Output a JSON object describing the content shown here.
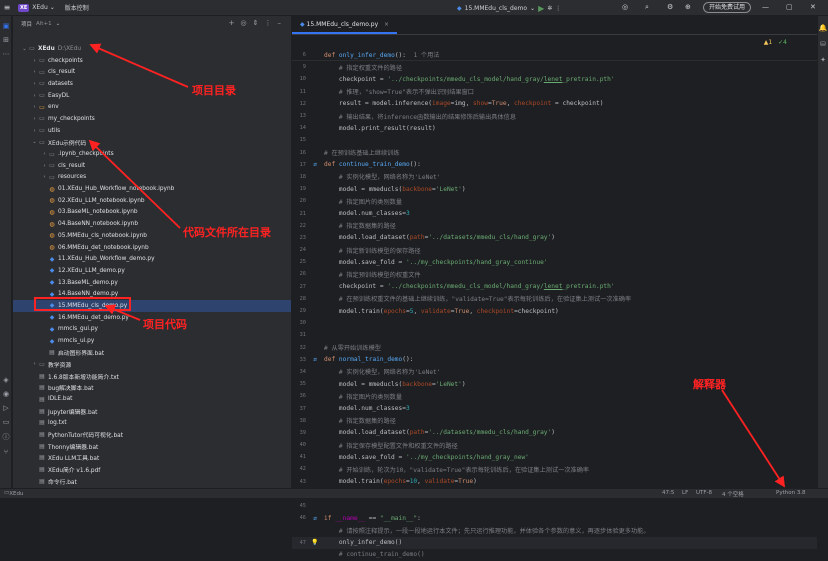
{
  "titlebar": {
    "logo": "XE",
    "project": "XEdu",
    "project_chev": "⌄",
    "vcs": "版本控制",
    "run_config": "15.MMEdu_cls_demo",
    "trial_button": "开始免费试用"
  },
  "project_panel": {
    "title": "项目",
    "shortcut": "Alt+1"
  },
  "tree": [
    {
      "label": "XEdu",
      "path": "D:\\XEdu",
      "depth": 0,
      "chev": "⌄",
      "icon": "folder-icon",
      "kind": "folder"
    },
    {
      "label": "checkpoints",
      "depth": 1,
      "chev": "›",
      "icon": "folder-icon",
      "kind": "folder"
    },
    {
      "label": "cls_result",
      "depth": 1,
      "chev": "›",
      "icon": "folder-icon",
      "kind": "folder"
    },
    {
      "label": "datasets",
      "depth": 1,
      "chev": "›",
      "icon": "folder-icon",
      "kind": "folder"
    },
    {
      "label": "EasyDL",
      "depth": 1,
      "chev": "›",
      "icon": "folder-icon",
      "kind": "folder"
    },
    {
      "label": "env",
      "depth": 1,
      "chev": "›",
      "icon": "folder-icon",
      "kind": "env"
    },
    {
      "label": "my_checkpoints",
      "depth": 1,
      "chev": "›",
      "icon": "folder-icon",
      "kind": "folder"
    },
    {
      "label": "utils",
      "depth": 1,
      "chev": "›",
      "icon": "folder-icon",
      "kind": "folder"
    },
    {
      "label": "XEdu示例代码",
      "depth": 1,
      "chev": "⌄",
      "icon": "folder-icon",
      "kind": "folder"
    },
    {
      "label": ".ipynb_checkpoints",
      "depth": 2,
      "chev": "›",
      "icon": "folder-icon",
      "kind": "folder"
    },
    {
      "label": "cls_result",
      "depth": 2,
      "chev": "›",
      "icon": "folder-icon",
      "kind": "folder"
    },
    {
      "label": "resources",
      "depth": 2,
      "chev": "›",
      "icon": "folder-icon",
      "kind": "folder"
    },
    {
      "label": "01.XEdu_Hub_Workflow_notebook.ipynb",
      "depth": 2,
      "icon": "notebook-icon",
      "kind": "nb"
    },
    {
      "label": "02.XEdu_LLM_notebook.ipynb",
      "depth": 2,
      "icon": "notebook-icon",
      "kind": "nb"
    },
    {
      "label": "03.BaseML_notebook.ipynb",
      "depth": 2,
      "icon": "notebook-icon",
      "kind": "nb"
    },
    {
      "label": "04.BaseNN_notebook.ipynb",
      "depth": 2,
      "icon": "notebook-icon",
      "kind": "nb"
    },
    {
      "label": "05.MMEdu_cls_notebook.ipynb",
      "depth": 2,
      "icon": "notebook-icon",
      "kind": "nb"
    },
    {
      "label": "06.MMEdu_det_notebook.ipynb",
      "depth": 2,
      "icon": "notebook-icon",
      "kind": "nb"
    },
    {
      "label": "11.XEdu_Hub_Workflow_demo.py",
      "depth": 2,
      "icon": "python-file-icon",
      "kind": "py"
    },
    {
      "label": "12.XEdu_LLM_demo.py",
      "depth": 2,
      "icon": "python-file-icon",
      "kind": "py"
    },
    {
      "label": "13.BaseML_demo.py",
      "depth": 2,
      "icon": "python-file-icon",
      "kind": "py"
    },
    {
      "label": "14.BaseNN_demo.py",
      "depth": 2,
      "icon": "python-file-icon",
      "kind": "py"
    },
    {
      "label": "15.MMEdu_cls_demo.py",
      "depth": 2,
      "icon": "python-file-icon",
      "kind": "py",
      "selected": true
    },
    {
      "label": "16.MMEdu_det_demo.py",
      "depth": 2,
      "icon": "python-file-icon",
      "kind": "py"
    },
    {
      "label": "mmcls_gui.py",
      "depth": 2,
      "icon": "python-file-icon",
      "kind": "py"
    },
    {
      "label": "mmcls_ui.py",
      "depth": 2,
      "icon": "python-file-icon",
      "kind": "py"
    },
    {
      "label": "启动图形界面.bat",
      "depth": 2,
      "icon": "text-file-icon",
      "kind": "txt"
    },
    {
      "label": "教学资源",
      "depth": 1,
      "chev": "›",
      "icon": "folder-icon",
      "kind": "folder"
    },
    {
      "label": "1.6.8版本新增功能简介.txt",
      "depth": 1,
      "icon": "text-file-icon",
      "kind": "txt"
    },
    {
      "label": "bug解决脚本.bat",
      "depth": 1,
      "icon": "text-file-icon",
      "kind": "txt"
    },
    {
      "label": "IDLE.bat",
      "depth": 1,
      "icon": "text-file-icon",
      "kind": "txt"
    },
    {
      "label": "Jupyter编辑器.bat",
      "depth": 1,
      "icon": "text-file-icon",
      "kind": "txt"
    },
    {
      "label": "log.txt",
      "depth": 1,
      "icon": "text-file-icon",
      "kind": "txt"
    },
    {
      "label": "PythonTutor代码可视化.bat",
      "depth": 1,
      "icon": "text-file-icon",
      "kind": "txt"
    },
    {
      "label": "Thonny编辑器.bat",
      "depth": 1,
      "icon": "text-file-icon",
      "kind": "txt"
    },
    {
      "label": "XEdu LLM工具.bat",
      "depth": 1,
      "icon": "text-file-icon",
      "kind": "txt"
    },
    {
      "label": "XEdu简介 v1.6.pdf",
      "depth": 1,
      "icon": "text-file-icon",
      "kind": "txt"
    },
    {
      "label": "命令行.bat",
      "depth": 1,
      "icon": "text-file-icon",
      "kind": "txt"
    }
  ],
  "annotations": {
    "project_dir": "项目目录",
    "code_dir": "代码文件所在目录",
    "project_code": "项目代码",
    "interpreter": "解释器"
  },
  "editor": {
    "tab": "15.MMEdu_cls_demo.py",
    "tab_close": "×",
    "breadcrumb_line": "6",
    "breadcrumb_fn": "only_infer_demo():",
    "breadcrumb_usage": "1 个用法",
    "warnings": "▲1",
    "checks": "✓4"
  },
  "code": [
    {
      "n": "6",
      "h": "<span class='k'>def</span> <span class='fn'>only_infer_demo</span>():  <span class='c'>1 个用法</span>",
      "bc": true
    },
    {
      "n": "9",
      "h": "    <span class='c'># 指定权重文件的路径</span>"
    },
    {
      "n": "10",
      "h": "    checkpoint = <span class='s'>'../checkpoints/mmedu_cls_model/hand_gray/<span class=\"u\">lenet</span>_pretrain.pth'</span>"
    },
    {
      "n": "11",
      "h": "    <span class='c'># 推理，\"show=True\"表示不弹出识别结果窗口</span>"
    },
    {
      "n": "12",
      "h": "    result = model.inference(<span class='pr'>image</span>=img, <span class='pr'>show</span>=<span class='k'>True</span>, <span class='pr'>checkpoint</span> = checkpoint)"
    },
    {
      "n": "13",
      "h": "    <span class='c'># 输出结果，将inference函数输出的结果修饰后输出具体信息</span>"
    },
    {
      "n": "14",
      "h": "    model.print_result(result)"
    },
    {
      "n": "15",
      "h": ""
    },
    {
      "n": "16",
      "h": "<span class='c'># 在预训练基础上继续训练</span>"
    },
    {
      "n": "17",
      "h": "<span class='k'>def</span> <span class='fn'>continue_train_demo</span>():",
      "g": "run"
    },
    {
      "n": "18",
      "h": "    <span class='c'># 实例化模型，网络名称为'LeNet'</span>"
    },
    {
      "n": "19",
      "h": "    model = mmeducls(<span class='pr'>backbone</span>=<span class='s'>'LeNet'</span>)"
    },
    {
      "n": "20",
      "h": "    <span class='c'># 指定图片的类别数量</span>"
    },
    {
      "n": "21",
      "h": "    model.num_classes=<span class='n'>3</span>"
    },
    {
      "n": "22",
      "h": "    <span class='c'># 指定数据集的路径</span>"
    },
    {
      "n": "23",
      "h": "    model.load_dataset(<span class='pr'>path</span>=<span class='s'>'../datasets/mmedu_cls/hand_gray'</span>)"
    },
    {
      "n": "24",
      "h": "    <span class='c'># 指定新训练模型的保存路径</span>"
    },
    {
      "n": "25",
      "h": "    model.save_fold = <span class='s'>'../my_checkpoints/hand_gray_continue'</span>"
    },
    {
      "n": "26",
      "h": "    <span class='c'># 指定预训练模型的权重文件</span>"
    },
    {
      "n": "27",
      "h": "    checkpoint = <span class='s'>'../checkpoints/mmedu_cls_model/hand_gray/<span class=\"u\">lenet</span>_pretrain.pth'</span>"
    },
    {
      "n": "28",
      "h": "    <span class='c'># 在预训练权重文件的基础上继续训练，\"validate=True\"表示每轮训练后，在验证集上测试一次准确率</span>"
    },
    {
      "n": "29",
      "h": "    model.train(<span class='pr'>epochs</span>=<span class='n'>5</span>, <span class='pr'>validate</span>=<span class='k'>True</span>, <span class='pr'>checkpoint</span>=checkpoint)"
    },
    {
      "n": "30",
      "h": ""
    },
    {
      "n": "31",
      "h": ""
    },
    {
      "n": "32",
      "h": "<span class='c'># 从零开始训练模型</span>"
    },
    {
      "n": "33",
      "h": "<span class='k'>def</span> <span class='fn'>normal_train_demo</span>():",
      "g": "run"
    },
    {
      "n": "34",
      "h": "    <span class='c'># 实例化模型，网络名称为'LeNet'</span>"
    },
    {
      "n": "35",
      "h": "    model = mmeducls(<span class='pr'>backbone</span>=<span class='s'>'LeNet'</span>)"
    },
    {
      "n": "36",
      "h": "    <span class='c'># 指定图片的类别数量</span>"
    },
    {
      "n": "37",
      "h": "    model.num_classes=<span class='n'>3</span>"
    },
    {
      "n": "38",
      "h": "    <span class='c'># 指定数据集的路径</span>"
    },
    {
      "n": "39",
      "h": "    model.load_dataset(<span class='pr'>path</span>=<span class='s'>'../datasets/mmedu_cls/hand_gray'</span>)"
    },
    {
      "n": "40",
      "h": "    <span class='c'># 指定保存模型配置文件和权重文件的路径</span>"
    },
    {
      "n": "41",
      "h": "    model.save_fold = <span class='s'>'../my_checkpoints/hand_gray_new'</span>"
    },
    {
      "n": "42",
      "h": "    <span class='c'># 开始训练，轮次为10，\"validate=True\"表示每轮训练后，在验证集上测试一次准确率</span>"
    },
    {
      "n": "43",
      "h": "    model.train(<span class='pr'>epochs</span>=<span class='n'>10</span>, <span class='pr'>validate</span>=<span class='k'>True</span>)"
    },
    {
      "n": "44",
      "h": "    <span class='c'># 训练结束后，可以用\"model.inference\"进行推理，看看效果。</span>"
    },
    {
      "n": "45",
      "h": ""
    },
    {
      "n": "46",
      "h": "<span class='k'>if</span> <span class='m'>__name__</span> == <span class='s'>\"__main__\"</span>:",
      "g": "run"
    },
    {
      "n": "",
      "h": "    <span class='c'># 请按照注释提示，一段一段地运行本文件；先只运行推理功能，并体验各个参数的意义，再逐步体验更多功能。</span>"
    },
    {
      "n": "47",
      "h": "    only_infer_demo()",
      "g": "bulb",
      "cur": true
    },
    {
      "n": "",
      "h": "    <span class='c'># continue_train_demo()</span>"
    }
  ],
  "statusbar": {
    "project": "XEdu",
    "position": "47:5",
    "line_sep": "LF",
    "encoding": "UTF-8",
    "indent": "4 个空格",
    "interpreter": "Python 3.8"
  }
}
